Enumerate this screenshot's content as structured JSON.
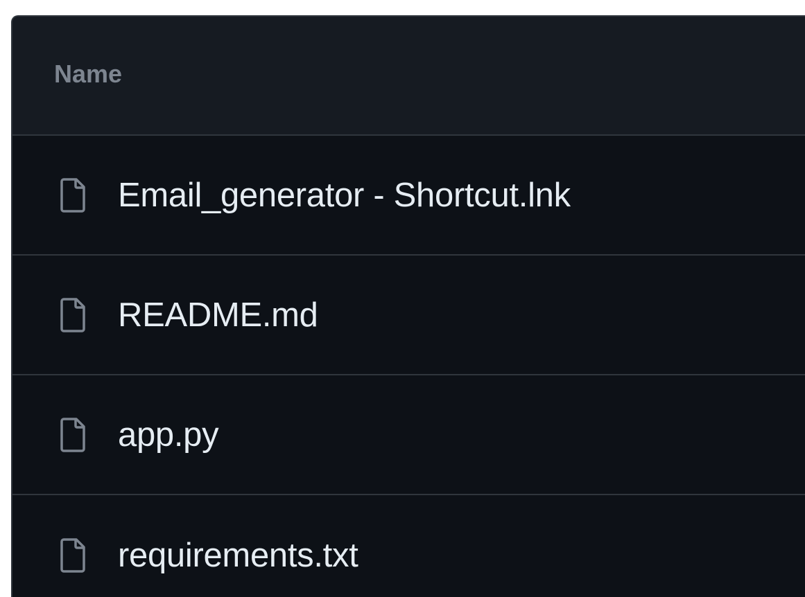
{
  "file_table": {
    "header": {
      "name_label": "Name"
    },
    "rows": [
      {
        "icon": "file-icon",
        "name": "Email_generator - Shortcut.lnk"
      },
      {
        "icon": "file-icon",
        "name": "README.md"
      },
      {
        "icon": "file-icon",
        "name": "app.py"
      },
      {
        "icon": "file-icon",
        "name": "requirements.txt"
      }
    ]
  },
  "colors": {
    "background": "#0d1117",
    "header_background": "#161b22",
    "border": "#30363d",
    "text_primary": "#e6edf3",
    "text_muted": "#7d8590",
    "icon": "#7d8590"
  }
}
